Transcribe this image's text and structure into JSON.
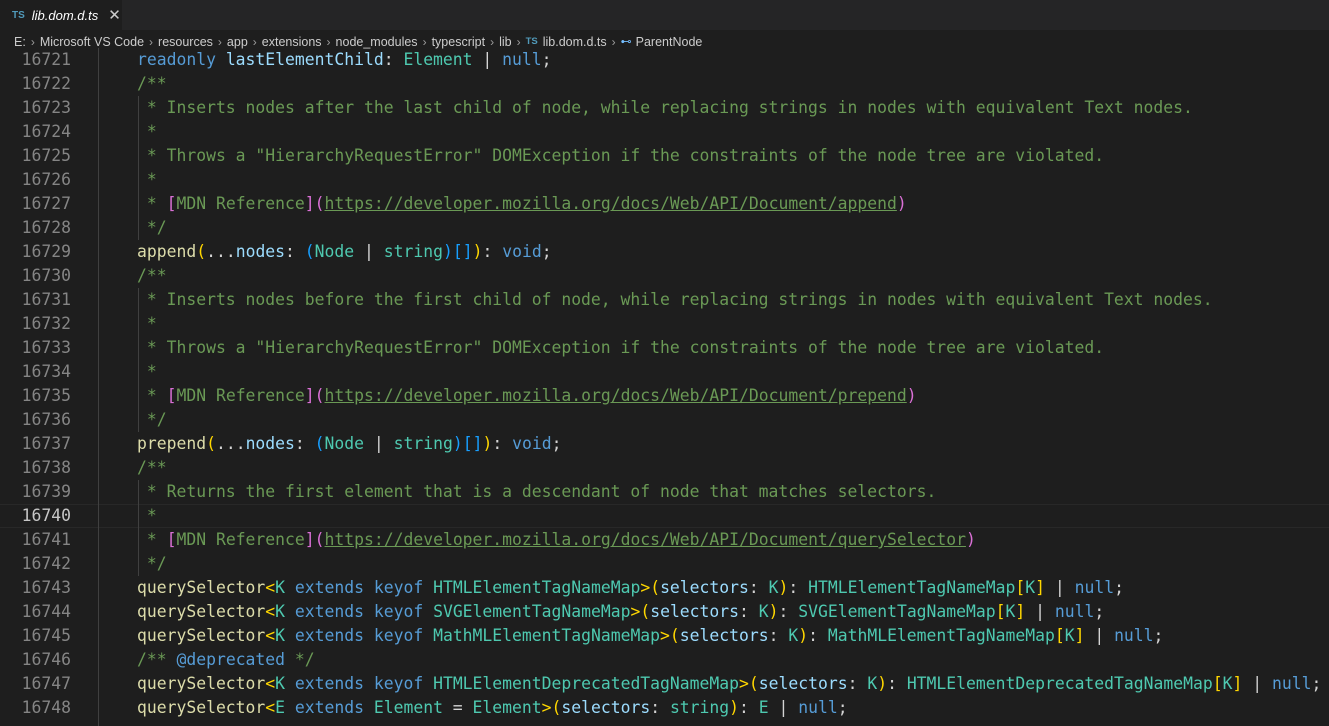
{
  "tab": {
    "badge": "TS",
    "title": "lib.dom.d.ts",
    "close": "✕"
  },
  "breadcrumb": {
    "items": [
      "E:",
      "Microsoft VS Code",
      "resources",
      "app",
      "extensions",
      "node_modules",
      "typescript",
      "lib",
      "lib.dom.d.ts",
      "ParentNode"
    ],
    "file_badge": "TS",
    "symbol_icon": "⊷"
  },
  "colors": {
    "keyword": "#569cd6",
    "variable": "#9cdcfe",
    "function": "#dcdcaa",
    "type": "#4ec9b0",
    "comment": "#6a9955",
    "bracket1": "#ffd700",
    "bracket2": "#da70d6",
    "bracket3": "#179fff"
  },
  "current_line": "16740",
  "lines": [
    {
      "n": "16721",
      "s": [
        [
          "  readonly ",
          "kw"
        ],
        [
          "lastElementChild",
          "var"
        ],
        [
          ": ",
          "pl"
        ],
        [
          "Element",
          "type"
        ],
        [
          " | ",
          "pl"
        ],
        [
          "null",
          "kw"
        ],
        [
          ";",
          "pl"
        ]
      ]
    },
    {
      "n": "16722",
      "s": [
        [
          "/**",
          "cm"
        ]
      ]
    },
    {
      "n": "16723",
      "s": [
        [
          " * Inserts nodes after the last child of node, while replacing strings in nodes with equivalent Text nodes.",
          "cm"
        ]
      ]
    },
    {
      "n": "16724",
      "s": [
        [
          " *",
          "cm"
        ]
      ]
    },
    {
      "n": "16725",
      "s": [
        [
          " * Throws a \"HierarchyRequestError\" DOMException if the constraints of the node tree are violated.",
          "cm"
        ]
      ]
    },
    {
      "n": "16726",
      "s": [
        [
          " *",
          "cm"
        ]
      ]
    },
    {
      "n": "16727",
      "s": [
        [
          " * ",
          "cm"
        ],
        [
          "[",
          "p2"
        ],
        [
          "MDN Reference",
          "cm"
        ],
        [
          "]",
          "p2"
        ],
        [
          "(",
          "p2"
        ],
        [
          "https://developer.mozilla.org/docs/Web/API/Document/append",
          "link"
        ],
        [
          ")",
          "p2"
        ]
      ]
    },
    {
      "n": "16728",
      "s": [
        [
          " */",
          "cm"
        ]
      ]
    },
    {
      "n": "16729",
      "s": [
        [
          "append",
          "fn"
        ],
        [
          "(",
          "p1"
        ],
        [
          "...",
          "pl"
        ],
        [
          "nodes",
          "var"
        ],
        [
          ": ",
          "pl"
        ],
        [
          "(",
          "p3"
        ],
        [
          "Node",
          "type"
        ],
        [
          " | ",
          "pl"
        ],
        [
          "string",
          "type"
        ],
        [
          ")",
          "p3"
        ],
        [
          "[]",
          "p3"
        ],
        [
          ")",
          "p1"
        ],
        [
          ": ",
          "pl"
        ],
        [
          "void",
          "kw"
        ],
        [
          ";",
          "pl"
        ]
      ]
    },
    {
      "n": "16730",
      "s": [
        [
          "/**",
          "cm"
        ]
      ]
    },
    {
      "n": "16731",
      "s": [
        [
          " * Inserts nodes before the first child of node, while replacing strings in nodes with equivalent Text nodes.",
          "cm"
        ]
      ]
    },
    {
      "n": "16732",
      "s": [
        [
          " *",
          "cm"
        ]
      ]
    },
    {
      "n": "16733",
      "s": [
        [
          " * Throws a \"HierarchyRequestError\" DOMException if the constraints of the node tree are violated.",
          "cm"
        ]
      ]
    },
    {
      "n": "16734",
      "s": [
        [
          " *",
          "cm"
        ]
      ]
    },
    {
      "n": "16735",
      "s": [
        [
          " * ",
          "cm"
        ],
        [
          "[",
          "p2"
        ],
        [
          "MDN Reference",
          "cm"
        ],
        [
          "]",
          "p2"
        ],
        [
          "(",
          "p2"
        ],
        [
          "https://developer.mozilla.org/docs/Web/API/Document/prepend",
          "link"
        ],
        [
          ")",
          "p2"
        ]
      ]
    },
    {
      "n": "16736",
      "s": [
        [
          " */",
          "cm"
        ]
      ]
    },
    {
      "n": "16737",
      "s": [
        [
          "prepend",
          "fn"
        ],
        [
          "(",
          "p1"
        ],
        [
          "...",
          "pl"
        ],
        [
          "nodes",
          "var"
        ],
        [
          ": ",
          "pl"
        ],
        [
          "(",
          "p3"
        ],
        [
          "Node",
          "type"
        ],
        [
          " | ",
          "pl"
        ],
        [
          "string",
          "type"
        ],
        [
          ")",
          "p3"
        ],
        [
          "[]",
          "p3"
        ],
        [
          ")",
          "p1"
        ],
        [
          ": ",
          "pl"
        ],
        [
          "void",
          "kw"
        ],
        [
          ";",
          "pl"
        ]
      ]
    },
    {
      "n": "16738",
      "s": [
        [
          "/**",
          "cm"
        ]
      ]
    },
    {
      "n": "16739",
      "s": [
        [
          " * Returns the first element that is a descendant of node that matches selectors.",
          "cm"
        ]
      ]
    },
    {
      "n": "16740",
      "s": [
        [
          " *",
          "cm"
        ]
      ]
    },
    {
      "n": "16741",
      "s": [
        [
          " * ",
          "cm"
        ],
        [
          "[",
          "p2"
        ],
        [
          "MDN Reference",
          "cm"
        ],
        [
          "]",
          "p2"
        ],
        [
          "(",
          "p2"
        ],
        [
          "https://developer.mozilla.org/docs/Web/API/Document/querySelector",
          "link"
        ],
        [
          ")",
          "p2"
        ]
      ]
    },
    {
      "n": "16742",
      "s": [
        [
          " */",
          "cm"
        ]
      ]
    },
    {
      "n": "16743",
      "s": [
        [
          "querySelector",
          "fn"
        ],
        [
          "<",
          "p1"
        ],
        [
          "K",
          "type"
        ],
        [
          " extends ",
          "kw"
        ],
        [
          "keyof ",
          "kw"
        ],
        [
          "HTMLElementTagNameMap",
          "type"
        ],
        [
          ">",
          "p1"
        ],
        [
          "(",
          "p1"
        ],
        [
          "selectors",
          "var"
        ],
        [
          ": ",
          "pl"
        ],
        [
          "K",
          "type"
        ],
        [
          ")",
          "p1"
        ],
        [
          ": ",
          "pl"
        ],
        [
          "HTMLElementTagNameMap",
          "type"
        ],
        [
          "[",
          "p1"
        ],
        [
          "K",
          "type"
        ],
        [
          "]",
          "p1"
        ],
        [
          " | ",
          "pl"
        ],
        [
          "null",
          "kw"
        ],
        [
          ";",
          "pl"
        ]
      ]
    },
    {
      "n": "16744",
      "s": [
        [
          "querySelector",
          "fn"
        ],
        [
          "<",
          "p1"
        ],
        [
          "K",
          "type"
        ],
        [
          " extends ",
          "kw"
        ],
        [
          "keyof ",
          "kw"
        ],
        [
          "SVGElementTagNameMap",
          "type"
        ],
        [
          ">",
          "p1"
        ],
        [
          "(",
          "p1"
        ],
        [
          "selectors",
          "var"
        ],
        [
          ": ",
          "pl"
        ],
        [
          "K",
          "type"
        ],
        [
          ")",
          "p1"
        ],
        [
          ": ",
          "pl"
        ],
        [
          "SVGElementTagNameMap",
          "type"
        ],
        [
          "[",
          "p1"
        ],
        [
          "K",
          "type"
        ],
        [
          "]",
          "p1"
        ],
        [
          " | ",
          "pl"
        ],
        [
          "null",
          "kw"
        ],
        [
          ";",
          "pl"
        ]
      ]
    },
    {
      "n": "16745",
      "s": [
        [
          "querySelector",
          "fn"
        ],
        [
          "<",
          "p1"
        ],
        [
          "K",
          "type"
        ],
        [
          " extends ",
          "kw"
        ],
        [
          "keyof ",
          "kw"
        ],
        [
          "MathMLElementTagNameMap",
          "type"
        ],
        [
          ">",
          "p1"
        ],
        [
          "(",
          "p1"
        ],
        [
          "selectors",
          "var"
        ],
        [
          ": ",
          "pl"
        ],
        [
          "K",
          "type"
        ],
        [
          ")",
          "p1"
        ],
        [
          ": ",
          "pl"
        ],
        [
          "MathMLElementTagNameMap",
          "type"
        ],
        [
          "[",
          "p1"
        ],
        [
          "K",
          "type"
        ],
        [
          "]",
          "p1"
        ],
        [
          " | ",
          "pl"
        ],
        [
          "null",
          "kw"
        ],
        [
          ";",
          "pl"
        ]
      ]
    },
    {
      "n": "16746",
      "s": [
        [
          "/** ",
          "cm"
        ],
        [
          "@deprecated",
          "kw"
        ],
        [
          " */",
          "cm"
        ]
      ]
    },
    {
      "n": "16747",
      "s": [
        [
          "querySelector",
          "fn"
        ],
        [
          "<",
          "p1"
        ],
        [
          "K",
          "type"
        ],
        [
          " extends ",
          "kw"
        ],
        [
          "keyof ",
          "kw"
        ],
        [
          "HTMLElementDeprecatedTagNameMap",
          "type"
        ],
        [
          ">",
          "p1"
        ],
        [
          "(",
          "p1"
        ],
        [
          "selectors",
          "var"
        ],
        [
          ": ",
          "pl"
        ],
        [
          "K",
          "type"
        ],
        [
          ")",
          "p1"
        ],
        [
          ": ",
          "pl"
        ],
        [
          "HTMLElementDeprecatedTagNameMap",
          "type"
        ],
        [
          "[",
          "p1"
        ],
        [
          "K",
          "type"
        ],
        [
          "]",
          "p1"
        ],
        [
          " | ",
          "pl"
        ],
        [
          "null",
          "kw"
        ],
        [
          ";",
          "pl"
        ]
      ]
    },
    {
      "n": "16748",
      "s": [
        [
          "querySelector",
          "fn"
        ],
        [
          "<",
          "p1"
        ],
        [
          "E",
          "type"
        ],
        [
          " extends ",
          "kw"
        ],
        [
          "Element",
          "type"
        ],
        [
          " = ",
          "pl"
        ],
        [
          "Element",
          "type"
        ],
        [
          ">",
          "p1"
        ],
        [
          "(",
          "p1"
        ],
        [
          "selectors",
          "var"
        ],
        [
          ": ",
          "pl"
        ],
        [
          "string",
          "type"
        ],
        [
          ")",
          "p1"
        ],
        [
          ": ",
          "pl"
        ],
        [
          "E",
          "type"
        ],
        [
          " | ",
          "pl"
        ],
        [
          "null",
          "kw"
        ],
        [
          ";",
          "pl"
        ]
      ]
    }
  ]
}
